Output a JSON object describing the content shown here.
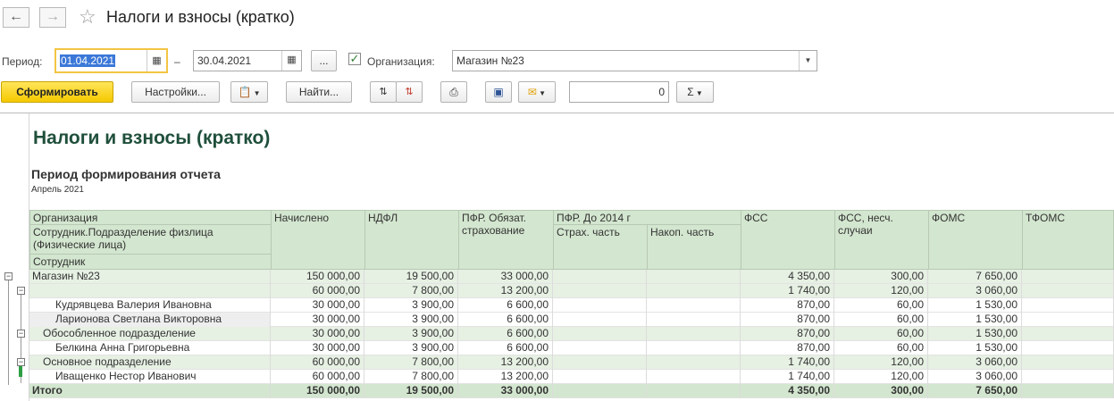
{
  "window": {
    "title": "Налоги и взносы (кратко)"
  },
  "params": {
    "period_label": "Период:",
    "date_from": "01.04.2021",
    "dash": "–",
    "date_to": "30.04.2021",
    "more_label": "...",
    "org_label": "Организация:",
    "org_value": "Магазин №23"
  },
  "toolbar": {
    "generate": "Сформировать",
    "settings": "Настройки...",
    "find": "Найти...",
    "sum_value": "0",
    "sigma": "Σ"
  },
  "report": {
    "title": "Налоги и взносы (кратко)",
    "subtitle": "Период формирования отчета",
    "period": "Апрель 2021",
    "headers": {
      "org": "Организация",
      "division": "Сотрудник.Подразделение физлица (Физические лица)",
      "employee": "Сотрудник",
      "accrued": "Начислено",
      "ndfl": "НДФЛ",
      "pfr_mand": "ПФР. Обязат. страхование",
      "pfr_2014": "ПФР. До 2014 г",
      "pfr_ins": "Страх. часть",
      "pfr_acc": "Накоп. часть",
      "fss": "ФСС",
      "fss_ns": "ФСС, несч. случаи",
      "foms": "ФОМС",
      "tfoms": "ТФОМС"
    },
    "rows": [
      {
        "name": "Магазин №23",
        "accrued": "150 000,00",
        "ndfl": "19 500,00",
        "pfr": "33 000,00",
        "fss": "4 350,00",
        "fss_ns": "300,00",
        "foms": "7 650,00"
      },
      {
        "name": "",
        "accrued": "60 000,00",
        "ndfl": "7 800,00",
        "pfr": "13 200,00",
        "fss": "1 740,00",
        "fss_ns": "120,00",
        "foms": "3 060,00"
      },
      {
        "name": "Кудрявцева Валерия Ивановна",
        "accrued": "30 000,00",
        "ndfl": "3 900,00",
        "pfr": "6 600,00",
        "fss": "870,00",
        "fss_ns": "60,00",
        "foms": "1 530,00"
      },
      {
        "name": "Ларионова Светлана Викторовна",
        "accrued": "30 000,00",
        "ndfl": "3 900,00",
        "pfr": "6 600,00",
        "fss": "870,00",
        "fss_ns": "60,00",
        "foms": "1 530,00"
      },
      {
        "name": "Обособленное подразделение",
        "accrued": "30 000,00",
        "ndfl": "3 900,00",
        "pfr": "6 600,00",
        "fss": "870,00",
        "fss_ns": "60,00",
        "foms": "1 530,00"
      },
      {
        "name": "Белкина Анна Григорьевна",
        "accrued": "30 000,00",
        "ndfl": "3 900,00",
        "pfr": "6 600,00",
        "fss": "870,00",
        "fss_ns": "60,00",
        "foms": "1 530,00"
      },
      {
        "name": "Основное подразделение",
        "accrued": "60 000,00",
        "ndfl": "7 800,00",
        "pfr": "13 200,00",
        "fss": "1 740,00",
        "fss_ns": "120,00",
        "foms": "3 060,00"
      },
      {
        "name": "Иващенко Нестор Иванович",
        "accrued": "60 000,00",
        "ndfl": "7 800,00",
        "pfr": "13 200,00",
        "fss": "1 740,00",
        "fss_ns": "120,00",
        "foms": "3 060,00"
      }
    ],
    "total": {
      "name": "Итого",
      "accrued": "150 000,00",
      "ndfl": "19 500,00",
      "pfr": "33 000,00",
      "fss": "4 350,00",
      "fss_ns": "300,00",
      "foms": "7 650,00"
    }
  }
}
